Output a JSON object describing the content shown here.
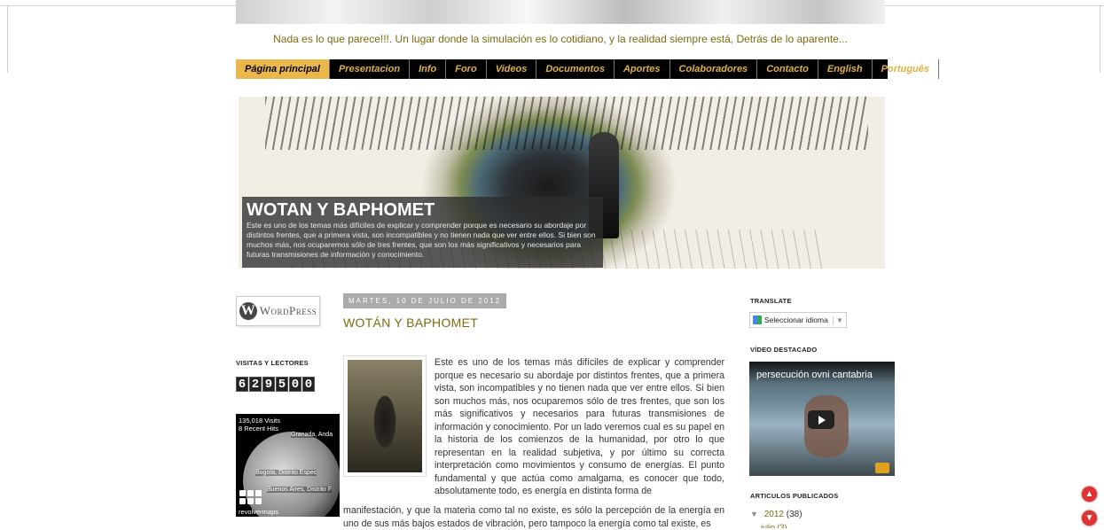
{
  "blog": {
    "tagline": "Nada es lo que parece!!!. Un lugar donde la simulación es lo cotidiano, y la realidad siempre está, Detrás de lo aparente..."
  },
  "nav": {
    "items": [
      "Página principal",
      "Presentacion",
      "Info",
      "Foro",
      "Videos",
      "Documentos",
      "Aportes",
      "Colaboradores",
      "Contacto",
      "English",
      "Português"
    ],
    "active": "Página principal"
  },
  "hero": {
    "title": "WOTAN Y BAPHOMET",
    "text": "Este es uno de los temas más difíciles de explicar y comprender porque es necesario su abordaje por distintos frentes, que a primera vista, son incompatibles y no tienen nada que ver entre ellos. Si bien son muchos más, nos ocuparemos sólo de tres frentes, que son los más significativos y necesarios para futuras transmisiones de información y conocimiento."
  },
  "left_sidebar": {
    "wordpress_label": "WordPress",
    "visits_heading": "VISITAS Y LECTORES",
    "counter_digits": [
      "6",
      "2",
      "9",
      "5",
      "0",
      "0"
    ],
    "map": {
      "visits": "135,018 Visits",
      "recent": "8 Recent Hits",
      "labels": [
        "Granada, Anda",
        "Bogota, Distrito Espec",
        "Buenos Aires, Distrito F"
      ],
      "brand": "revolvermaps"
    }
  },
  "post": {
    "date": "MARTES, 10 DE JULIO DE 2012",
    "title": "WOTÁN Y BAPHOMET",
    "body": "Este es uno de los temas más difíciles de explicar y comprender porque es necesario su abordaje por distintos frentes, que a primera vista, son incompatibles y no tienen nada que ver entre ellos. Si bien son muchos más, nos ocuparemos sólo de tres frentes, que son los más significativos y necesarios para futuras transmisiones de información y conocimiento. Por un lado veremos cual es su papel en la historia de los comienzos de la humanidad, por otro lo que representan en la realidad subjetiva, y por último su correcta interpretación como movimientos y consumo de energías. El punto fundamental y que actúa como amalgama, es conocer que todo, absolutamente todo, es energía en distinta forma de",
    "body_cont": "manifestación, y que la materia como tal no existe, es sólo la percepción de la energía en uno de sus más bajos estados de vibración, pero tampoco la energía como tal existe, es"
  },
  "right_sidebar": {
    "translate_heading": "TRANSLATE",
    "translate_select": "Seleccionar idioma",
    "video_heading": "VÍDEO DESTACADO",
    "video_title": "persecución ovni cantabria",
    "archive_heading": "ARTICULOS PUBLICADOS",
    "archive_year": "2012",
    "archive_count": "(38)",
    "archive_sub": "julio (3)"
  },
  "colors": {
    "accent": "#7a6a10",
    "nav_bg": "#000000",
    "nav_text": "#e2b23f",
    "nav_active_bg": "#eab84a",
    "scroll_buttons": "#dd3333"
  }
}
